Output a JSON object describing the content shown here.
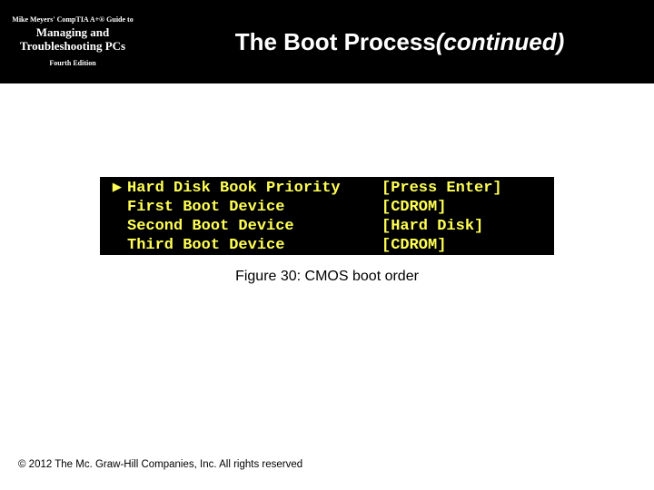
{
  "header": {
    "series": "Mike Meyers' CompTIA A+® Guide to",
    "subtitle": "Managing and Troubleshooting PCs",
    "edition": "Fourth Edition",
    "title_prefix": "The Boot Process ",
    "title_suffix": "(continued)"
  },
  "cmos": {
    "rows": [
      {
        "selected": true,
        "label": "Hard Disk Book Priority",
        "value": "[Press Enter]"
      },
      {
        "selected": false,
        "label": "First Boot Device",
        "value": "[CDROM]"
      },
      {
        "selected": false,
        "label": "Second Boot Device",
        "value": "[Hard Disk]"
      },
      {
        "selected": false,
        "label": "Third Boot Device",
        "value": "[CDROM]"
      }
    ]
  },
  "caption": "Figure 30: CMOS boot order",
  "copyright": "© 2012 The Mc. Graw-Hill Companies, Inc. All rights reserved"
}
